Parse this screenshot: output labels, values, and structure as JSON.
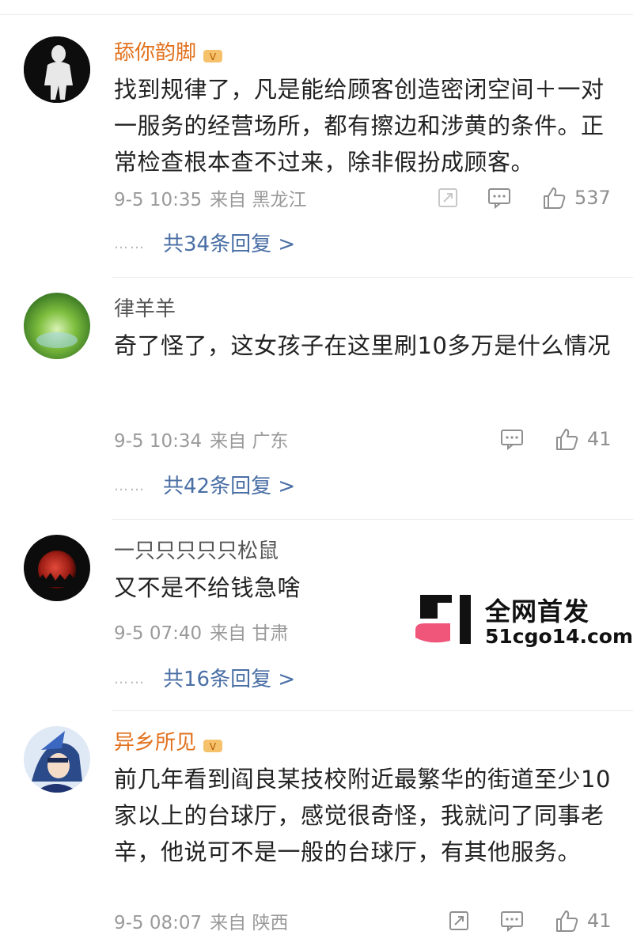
{
  "comments": [
    {
      "username": "舔你韵脚",
      "vip": true,
      "text": "找到规律了，凡是能给顾客创造密闭空间＋一对一服务的经营场所，都有擦边和涉黄的条件。正常检查根本查不过来，除非假扮成顾客。",
      "date": "9-5 10:35",
      "location": "来自 黑龙江",
      "likes": "537",
      "replies": "共34条回复 >"
    },
    {
      "username": "律羊羊",
      "vip": false,
      "text": "奇了怪了，这女孩子在这里刷10多万是什么情况",
      "date": "9-5 10:34",
      "location": "来自 广东",
      "likes": "41",
      "replies": "共42条回复 >"
    },
    {
      "username": "一只只只只只松鼠",
      "vip": false,
      "text": "又不是不给钱急啥",
      "date": "9-5 07:40",
      "location": "来自 甘肃",
      "likes": "",
      "replies": "共16条回复 >"
    },
    {
      "username": "异乡所见",
      "vip": true,
      "text": "前几年看到阎良某技校附近最繁华的街道至少10家以上的台球厅，感觉很奇怪，我就问了同事老辛，他说可不是一般的台球厅，有其他服务。",
      "date": "9-5 08:07",
      "location": "来自 陕西",
      "likes": "41",
      "replies": ""
    }
  ],
  "watermark": {
    "line1": "全网首发",
    "line2": "51cgo14.com"
  },
  "icons": {
    "share": "share-icon",
    "comment": "comment-icon",
    "like": "thumbs-up-icon",
    "vip_badge": "vip-badge-icon"
  },
  "colors": {
    "vip_name": "#e2711d",
    "reply_link": "#4a6fa5",
    "meta": "#9a9a9a"
  }
}
